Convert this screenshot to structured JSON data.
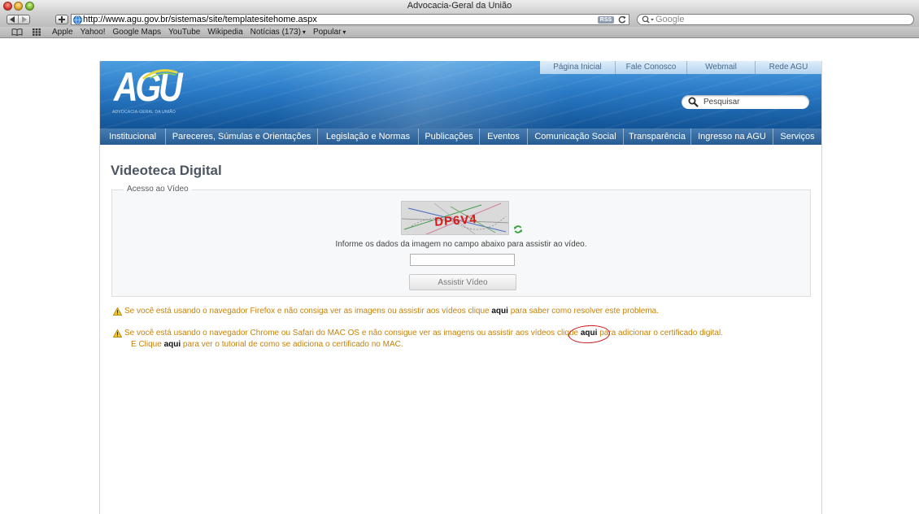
{
  "window": {
    "title": "Advocacia-Geral da União"
  },
  "toolbar": {
    "url": "http://www.agu.gov.br/sistemas/site/templatesitehome.aspx",
    "rss_label": "RSS",
    "search_placeholder": "Google"
  },
  "bookmarks": {
    "items": [
      {
        "label": "Apple",
        "menu": false
      },
      {
        "label": "Yahoo!",
        "menu": false
      },
      {
        "label": "Google Maps",
        "menu": false
      },
      {
        "label": "YouTube",
        "menu": false
      },
      {
        "label": "Wikipedia",
        "menu": false
      },
      {
        "label": "Notícias (173)",
        "menu": true
      },
      {
        "label": "Popular",
        "menu": true
      }
    ]
  },
  "site": {
    "top_links": [
      "Página Inicial",
      "Fale Conosco",
      "Webmail",
      "Rede AGU"
    ],
    "logo_text": "AGU",
    "logo_subtitle": "ADVOCACIA-GERAL DA UNIÃO",
    "search_placeholder": "Pesquisar",
    "search_icon": "search-icon",
    "nav": [
      "Institucional",
      "Pareceres, Súmulas e Orientações",
      "Legislação e Normas",
      "Publicações",
      "Eventos",
      "Comunicação Social",
      "Transparência",
      "Ingresso na AGU",
      "Serviços"
    ]
  },
  "main": {
    "title": "Videoteca Digital",
    "legend": "Acesso ao Vídeo",
    "captcha_text": "DP6V4",
    "instruction": "Informe os dados da imagem no campo abaixo para assistir ao vídeo.",
    "submit_label": "Assistir Vídeo"
  },
  "notices": [
    {
      "icon": "warning-icon",
      "before": "Se você está usando o navegador Firefox e não consiga ver as imagens ou assistir aos vídeos clique ",
      "link": "aqui",
      "after": " para saber como resolver este problema."
    },
    {
      "icon": "warning-icon",
      "before": "Se você está usando o navegador Chrome ou Safari do MAC OS e não consigue ver as imagens ou assistir aos vídeos clique ",
      "link": "aqui",
      "after": " para adicionar o certificado digital.",
      "line2": {
        "before": "E Clique ",
        "link": "aqui",
        "after": " para ver o tutorial de como se adiciona o certificado no MAC."
      }
    }
  ],
  "colors": {
    "nav_bar": "#2a68a6",
    "notice_text": "#c68209",
    "annotation": "#d0151b"
  }
}
